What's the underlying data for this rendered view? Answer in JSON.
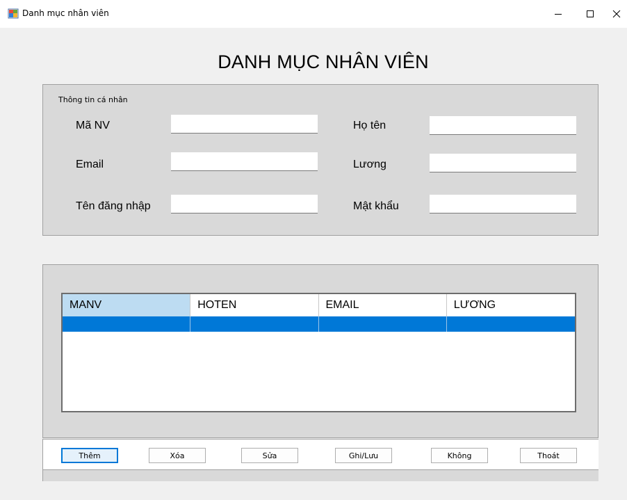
{
  "window": {
    "title": "Danh mục nhân viên",
    "icon": "winforms-app-icon",
    "controls": {
      "minimize": "minimize-icon",
      "maximize": "maximize-icon",
      "close": "close-icon"
    }
  },
  "heading": "DANH MỤC NHÂN VIÊN",
  "personal_info": {
    "caption": "Thông tin cá nhân",
    "fields": [
      {
        "label": "Mã NV",
        "value": ""
      },
      {
        "label": "Họ tên",
        "value": ""
      },
      {
        "label": "Email",
        "value": ""
      },
      {
        "label": "Lương",
        "value": ""
      },
      {
        "label": "Tên đăng nhập",
        "value": ""
      },
      {
        "label": "Mật khẩu",
        "value": ""
      }
    ]
  },
  "grid": {
    "columns": [
      "MANV",
      "HOTEN",
      "EMAIL",
      "LƯƠNG"
    ],
    "rows": [
      [
        "",
        "",
        "",
        ""
      ]
    ],
    "selected_row": 0,
    "selection_color": "#0078d7"
  },
  "buttons": {
    "add": "Thêm",
    "delete": "Xóa",
    "edit": "Sửa",
    "save": "Ghi/Lưu",
    "cancel": "Không",
    "exit": "Thoát"
  },
  "colors": {
    "accent": "#0078d7",
    "panel": "#d9d9d9",
    "header_selected": "#bddcf2"
  }
}
